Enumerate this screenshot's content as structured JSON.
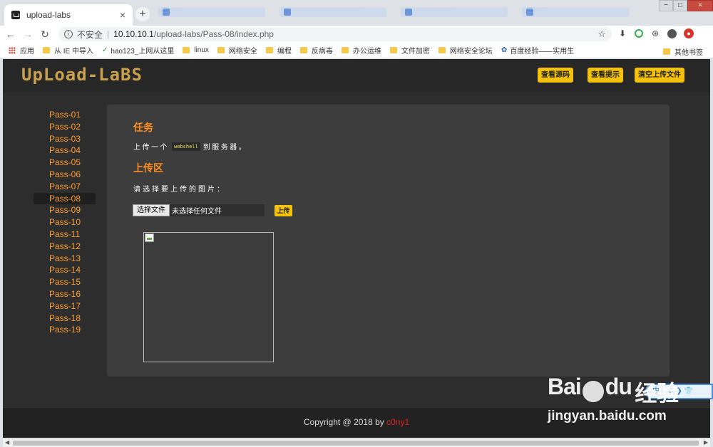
{
  "browser": {
    "tab_title": "upload-labs",
    "tab_close": "×",
    "new_tab": "+",
    "win_minimize": "−",
    "win_maximize": "□",
    "win_close": "×",
    "security_label": "不安全",
    "address_separator": "|",
    "url_host": "10.10.10.1",
    "url_path": "/upload-labs/Pass-08/index.php",
    "bookmarks": [
      {
        "label": "应用",
        "icon": "apps-icon"
      },
      {
        "label": "从 IE 中导入",
        "icon": "folder-icon"
      },
      {
        "label": "hao123_上网从这里",
        "icon": "check-icon"
      },
      {
        "label": "linux",
        "icon": "folder-icon"
      },
      {
        "label": "网络安全",
        "icon": "folder-icon"
      },
      {
        "label": "编程",
        "icon": "folder-icon"
      },
      {
        "label": "反病毒",
        "icon": "folder-icon"
      },
      {
        "label": "办公运维",
        "icon": "folder-icon"
      },
      {
        "label": "文件加密",
        "icon": "folder-icon"
      },
      {
        "label": "网络安全论坛",
        "icon": "folder-icon"
      },
      {
        "label": "百度经验——实用生",
        "icon": "paw-icon"
      }
    ],
    "other_bookmarks": "其他书签"
  },
  "header": {
    "logo": "UpLoad-LaBS",
    "buttons": [
      "查看源码",
      "查看提示",
      "清空上传文件"
    ]
  },
  "sidebar": {
    "items": [
      "Pass-01",
      "Pass-02",
      "Pass-03",
      "Pass-04",
      "Pass-05",
      "Pass-06",
      "Pass-07",
      "Pass-08",
      "Pass-09",
      "Pass-10",
      "Pass-11",
      "Pass-12",
      "Pass-13",
      "Pass-14",
      "Pass-15",
      "Pass-16",
      "Pass-17",
      "Pass-18",
      "Pass-19"
    ],
    "active": "Pass-08"
  },
  "main": {
    "task_title": "任务",
    "task_prefix": "上传一个",
    "task_code": "webshell",
    "task_suffix": "到服务器。",
    "upload_title": "上传区",
    "choose_prompt": "请选择要上传的图片：",
    "file_button": "选择文件",
    "file_status": "未选择任何文件",
    "upload_button": "上传"
  },
  "footer": {
    "copyright": "Copyright @ 2018 by ",
    "author": "c0ny1"
  },
  "watermark": {
    "brand": "Bai",
    "brand_end": "du",
    "product": "经验",
    "site": "jingyan.baidu.com",
    "widget": "中 ♪ ☺ ❯ 👕"
  },
  "colors": {
    "accent_orange": "#ff8d1f",
    "button_yellow": "#f4c20d",
    "page_bg": "#2d2d2d",
    "panel_bg": "#3d3d3d"
  }
}
